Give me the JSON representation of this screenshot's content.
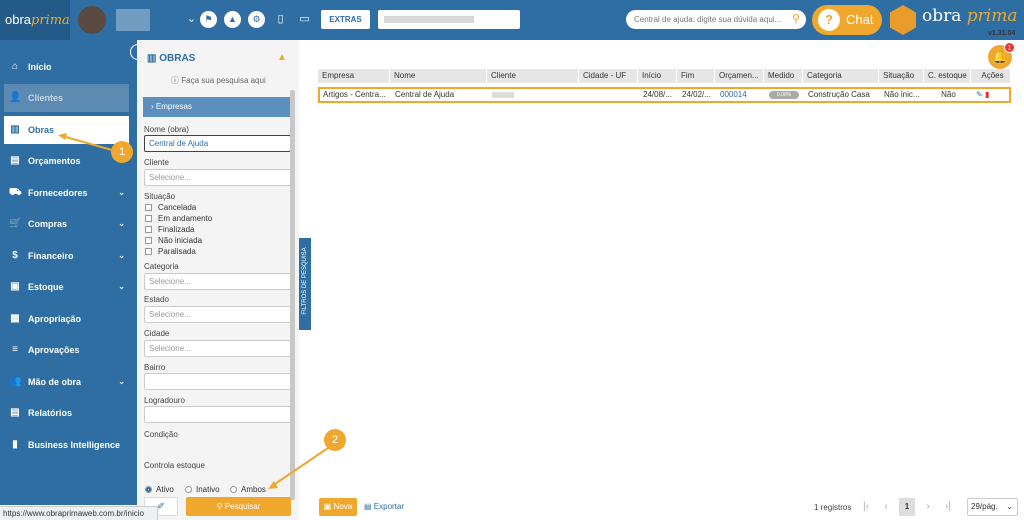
{
  "header": {
    "logo_text_plain": "obra",
    "logo_text_italic": "prima",
    "extras_label": "EXTRAS",
    "search_placeholder": "Central de ajuda: digite sua dúvida aqui...",
    "chat_label": "Chat",
    "brand_plain": "obra",
    "brand_italic": "prima",
    "version": "v1.31.04",
    "icons": [
      "chevron-down-icon",
      "flag-icon",
      "graduation-cap-icon",
      "gear-icon",
      "tablet-icon",
      "monitor-icon"
    ]
  },
  "sidebar": {
    "items": [
      {
        "label": "Início",
        "icon": "home-icon",
        "glyph": "⌂",
        "state": "normal",
        "has_chevron": false
      },
      {
        "label": "Clientes",
        "icon": "person-icon",
        "glyph": "👤",
        "state": "disabled",
        "has_chevron": false
      },
      {
        "label": "Obras",
        "icon": "building-icon",
        "glyph": "▥",
        "state": "active",
        "has_chevron": false
      },
      {
        "label": "Orçamentos",
        "icon": "calculator-icon",
        "glyph": "▤",
        "state": "normal",
        "has_chevron": false
      },
      {
        "label": "Fornecedores",
        "icon": "truck-icon",
        "glyph": "⛟",
        "state": "normal",
        "has_chevron": true
      },
      {
        "label": "Compras",
        "icon": "cart-icon",
        "glyph": "🛒",
        "state": "normal",
        "has_chevron": true
      },
      {
        "label": "Financeiro",
        "icon": "dollar-icon",
        "glyph": "$",
        "state": "normal",
        "has_chevron": true
      },
      {
        "label": "Estoque",
        "icon": "box-icon",
        "glyph": "▣",
        "state": "normal",
        "has_chevron": true
      },
      {
        "label": "Apropriação",
        "icon": "document-icon",
        "glyph": "▦",
        "state": "normal",
        "has_chevron": false
      },
      {
        "label": "Aprovações",
        "icon": "checklist-icon",
        "glyph": "≡",
        "state": "normal",
        "has_chevron": false
      },
      {
        "label": "Mão de obra",
        "icon": "workers-icon",
        "glyph": "👥",
        "state": "normal",
        "has_chevron": true
      },
      {
        "label": "Relatórios",
        "icon": "report-icon",
        "glyph": "▤",
        "state": "normal",
        "has_chevron": false
      },
      {
        "label": "Business Intelligence",
        "icon": "bar-chart-icon",
        "glyph": "▮",
        "state": "normal",
        "has_chevron": false
      }
    ]
  },
  "markers": [
    "1",
    "2"
  ],
  "filter": {
    "title": "OBRAS",
    "hint": "Faça sua pesquisa aqui",
    "empresas_label": "Empresas",
    "nome_label": "Nome (obra)",
    "nome_value": "Central de Ajuda",
    "cliente_label": "Cliente",
    "select_placeholder": "Selecione...",
    "situacao_label": "Situação",
    "situacao_options": [
      "Cancelada",
      "Em andamento",
      "Finalizada",
      "Não iniciada",
      "Paralisada"
    ],
    "categoria_label": "Categoria",
    "estado_label": "Estado",
    "cidade_label": "Cidade",
    "bairro_label": "Bairro",
    "logradouro_label": "Logradouro",
    "condicao_label": "Condição",
    "condicao_options": [
      "Ativo",
      "Inativo",
      "Ambos"
    ],
    "condicao_selected": "Ativo",
    "controla_label": "Controla estoque",
    "search_button": "Pesquisar",
    "vertical_tab": "FILTROS DE PESQUISA"
  },
  "table": {
    "columns": [
      "Empresa",
      "Nome",
      "Cliente",
      "Cidade - UF",
      "Início",
      "Fim",
      "Orçamen...",
      "Medido",
      "Categoria",
      "Situação",
      "C. estoque",
      "Ações"
    ],
    "row": {
      "empresa": "Artigos - Centra...",
      "nome": "Central de Ajuda",
      "cidade_uf": "",
      "inicio": "24/08/...",
      "fim": "24/02/...",
      "orcamento": "000014",
      "medido": "0.00%",
      "categoria": "Construção Casa",
      "situacao": "Não inic...",
      "c_estoque": "Não"
    }
  },
  "notifications": {
    "count": "1"
  },
  "footer": {
    "nova_label": "Nova",
    "exportar_label": "Exportar",
    "registros": "1 registros",
    "current_page": "1",
    "per_page": "29/pág."
  },
  "status_url": "https://www.obraprimaweb.com.br/inicio"
}
